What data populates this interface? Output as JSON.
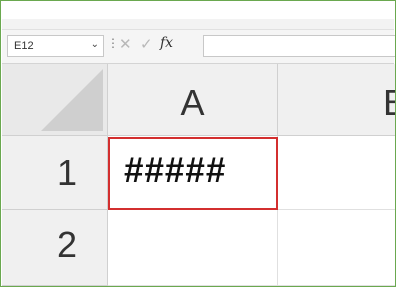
{
  "formula_bar": {
    "name_box_value": "E12",
    "name_box_dropdown_icon": "chevron-down-icon",
    "separator_glyph": "⋮",
    "cancel_icon": "close-icon",
    "cancel_glyph": "✕",
    "enter_icon": "check-icon",
    "enter_glyph": "✓",
    "fx_label": "fx",
    "formula_value": ""
  },
  "grid": {
    "columns": [
      "A",
      "B"
    ],
    "rows": [
      "1",
      "2"
    ],
    "cells": {
      "A1": "#####",
      "B1": "",
      "A2": "",
      "B2": ""
    }
  },
  "colors": {
    "frame_border": "#6aa84f",
    "highlight_border": "#d32f2f",
    "header_bg": "#f0f0f0"
  }
}
